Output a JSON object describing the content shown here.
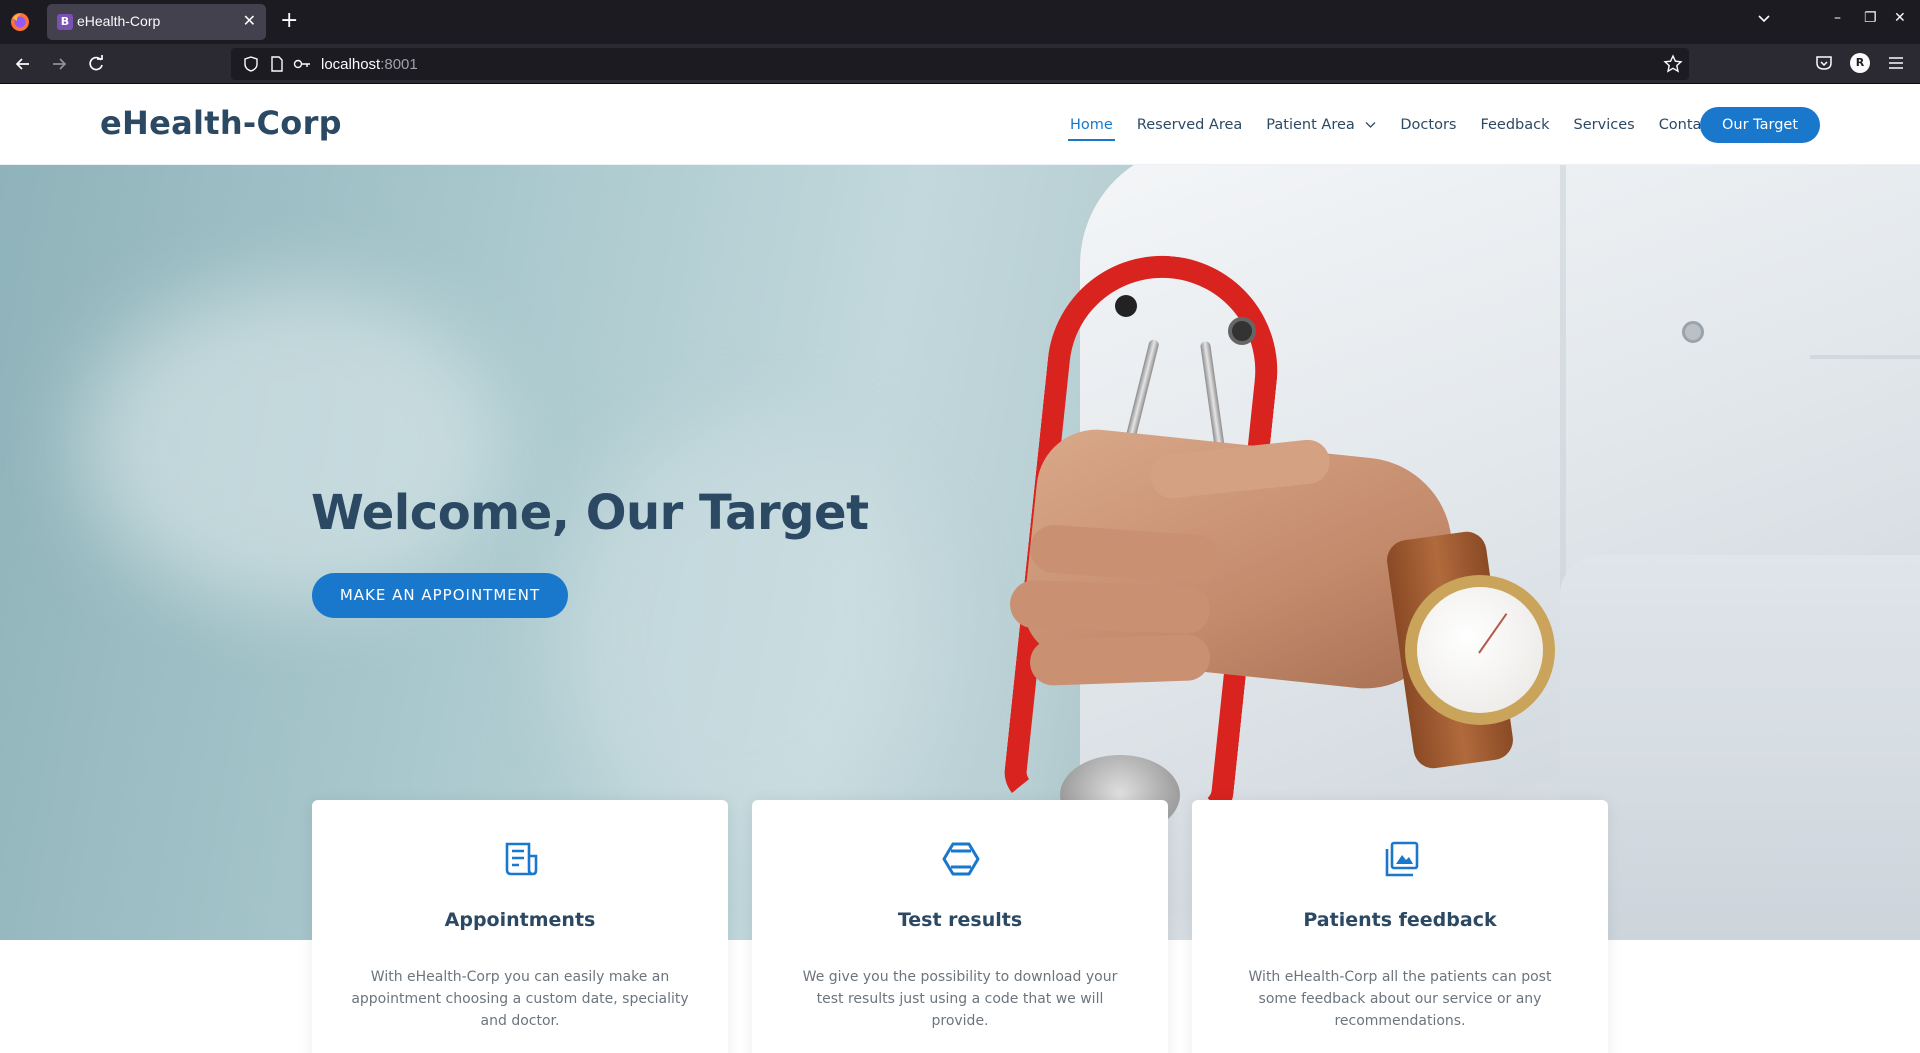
{
  "browser": {
    "tab_title": "eHealth-Corp",
    "tab_favicon_letter": "B",
    "url_host": "localhost",
    "url_port": ":8001",
    "profile_initial": "R"
  },
  "site": {
    "logo": "eHealth-Corp",
    "menu": [
      {
        "label": "Home",
        "active": true
      },
      {
        "label": "Reserved Area"
      },
      {
        "label": "Patient Area"
      },
      {
        "label": "Doctors"
      },
      {
        "label": "Feedback"
      },
      {
        "label": "Services"
      },
      {
        "label": "Contact"
      }
    ],
    "cta_label": "Our Target"
  },
  "hero": {
    "title": "Welcome, Our Target",
    "button_label": "MAKE AN APPOINTMENT"
  },
  "cards": [
    {
      "icon": "document-icon",
      "title": "Appointments",
      "text": "With eHealth-Corp you can easily make an appointment choosing a custom date, speciality and doctor."
    },
    {
      "icon": "hexagon-icon",
      "title": "Test results",
      "text": "We give you the possibility to download your test results just using a code that we will provide."
    },
    {
      "icon": "images-icon",
      "title": "Patients feedback",
      "text": "With eHealth-Corp all the patients can post some feedback about our service or any recommendations."
    }
  ],
  "colors": {
    "brand": "#1977cc",
    "heading": "#2c4964",
    "body_text": "#6c757d"
  }
}
